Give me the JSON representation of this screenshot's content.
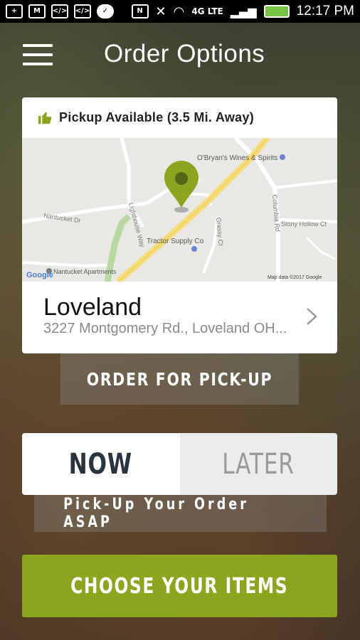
{
  "status_bar": {
    "time": "12:17 PM",
    "network": "4G LTE",
    "icons": [
      "plus-icon",
      "gmail-icon",
      "code-icon",
      "code-icon",
      "chat-icon",
      "nfc-icon",
      "mute-icon",
      "wifi-icon",
      "signal-icon",
      "battery-icon"
    ]
  },
  "header": {
    "title": "Order Options",
    "menu_icon": "hamburger-icon"
  },
  "location_card": {
    "pickup_status": "Pickup Available (3.5 Mi. Away)",
    "status_icon": "thumbs-up-icon",
    "location_name": "Loveland",
    "address": "3227 Montgomery Rd., Loveland OH...",
    "chevron_icon": "chevron-right-icon",
    "map": {
      "labels": [
        "O'Bryan's Wines & Spirits",
        "Tractor Supply Co",
        "Nantucket Apartments",
        "Nantucket Dr",
        "Lighthouse Way",
        "Grassy Ct",
        "Columbia Rd",
        "Stony Hollow Ct",
        "Google",
        "Map data ©2017 Google"
      ],
      "pin_icon": "map-pin-icon"
    }
  },
  "order_type_button": "ORDER FOR PICK-UP",
  "timing": {
    "options": [
      "NOW",
      "LATER"
    ],
    "selected": "NOW",
    "description": "Pick-Up Your Order ASAP"
  },
  "cta_button": "CHOOSE YOUR ITEMS",
  "colors": {
    "accent_green": "#8ba51f",
    "now_text": "#2a3440",
    "later_text": "#9a9a9a"
  }
}
